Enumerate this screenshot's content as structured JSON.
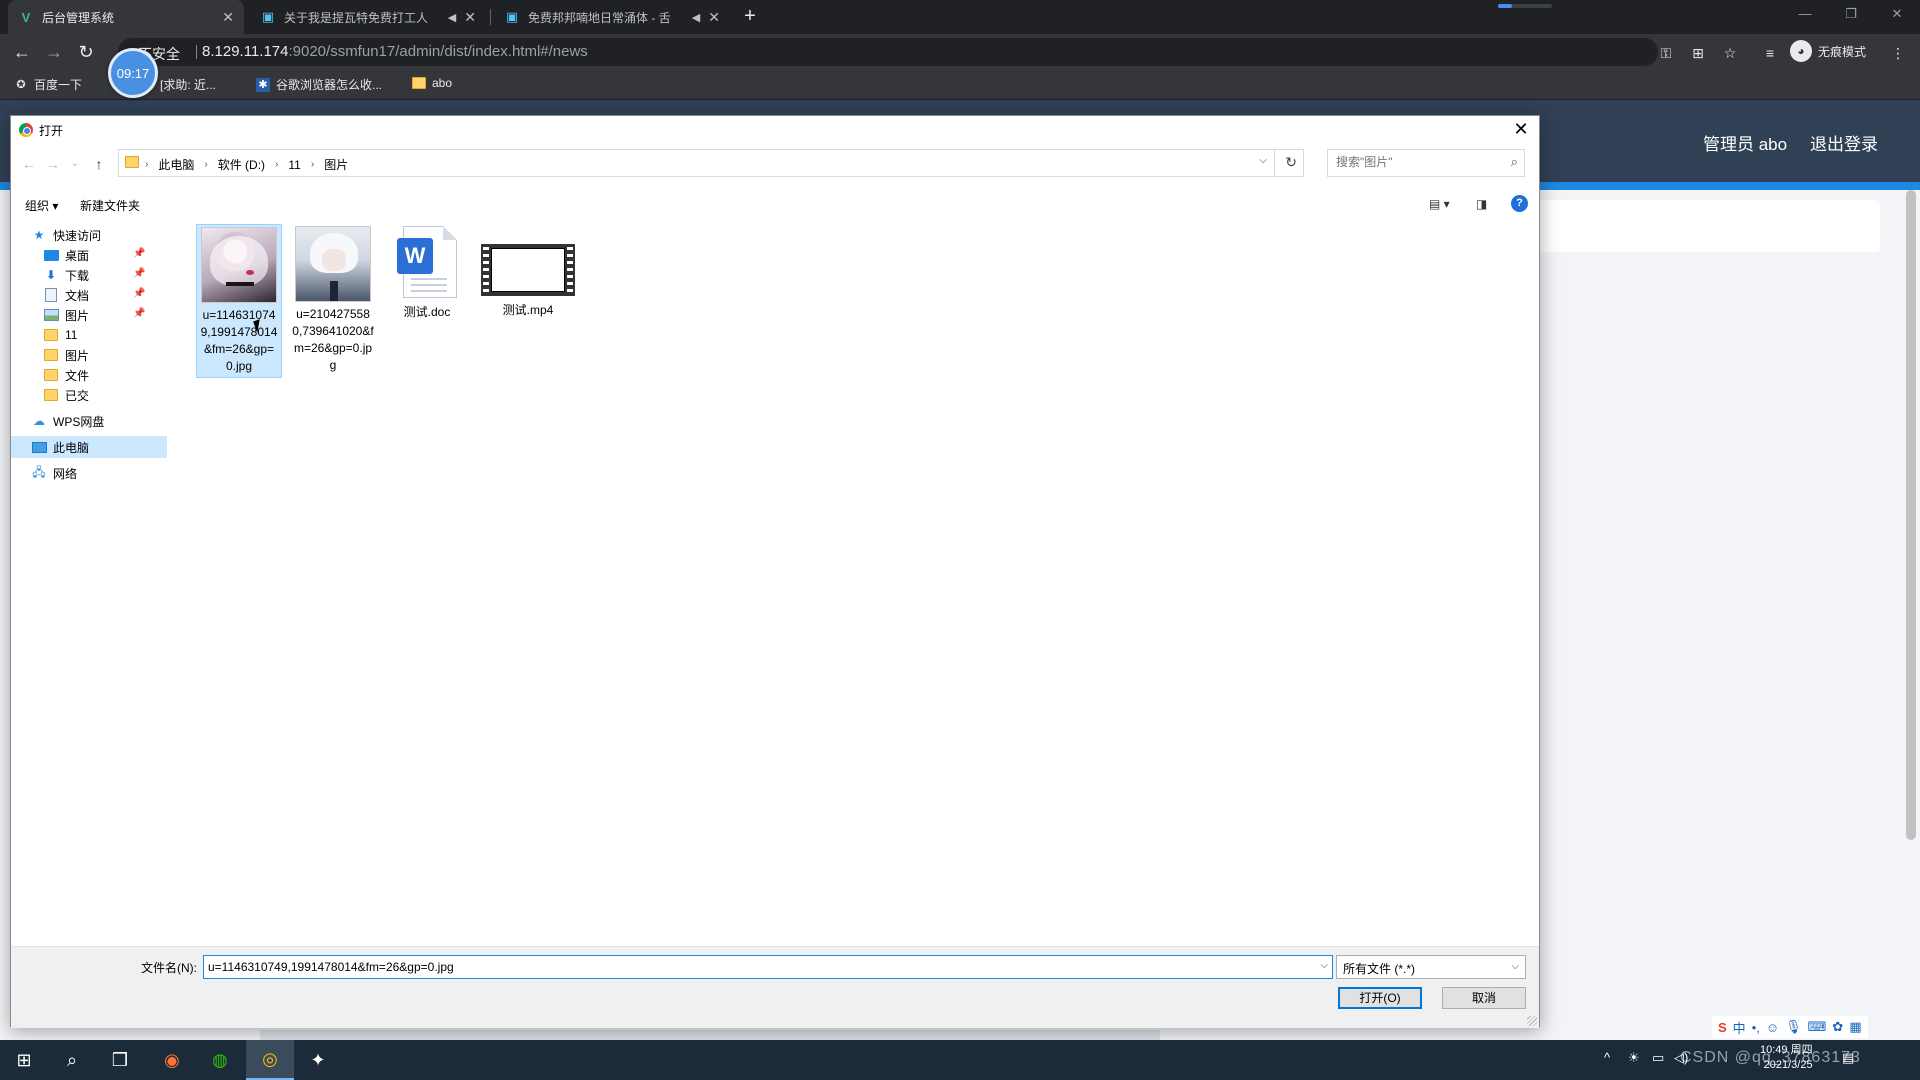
{
  "browser": {
    "tabs": [
      {
        "title": "后台管理系统",
        "icon": "vue-logo-icon",
        "active": true
      },
      {
        "title": "关于我是提瓦特免费打工人",
        "icon": "bilibili-icon",
        "active": false
      },
      {
        "title": "免费邦邦喃地日常涌体 - 舌",
        "icon": "bilibili-icon",
        "active": false
      }
    ],
    "address": {
      "security_label": "不安全",
      "host": "8.129.11.174",
      "path": ":9020/ssmfun17/admin/dist/index.html#/news"
    },
    "incognito_label": "无痕模式",
    "bookmarks": [
      {
        "label": "百度一下",
        "icon": "baidu-icon"
      },
      {
        "label": "[求助: 近...",
        "icon": "bookmark-icon"
      },
      {
        "label": "谷歌浏览器怎么收...",
        "icon": "bookmark-icon"
      },
      {
        "label": "abo",
        "icon": "folder-icon"
      }
    ],
    "timer_badge": "09:17"
  },
  "app": {
    "admin_user": "管理员 abo",
    "logout_label": "退出登录"
  },
  "dialog": {
    "title": "打开",
    "breadcrumbs": [
      "此电脑",
      "软件 (D:)",
      "11",
      "图片"
    ],
    "search_placeholder": "搜索\"图片\"",
    "organize_label": "组织 ▾",
    "new_folder_label": "新建文件夹",
    "help_label": "?",
    "nav": {
      "quick_access": "快速访问",
      "items": [
        {
          "label": "桌面",
          "pinned": true
        },
        {
          "label": "下载",
          "pinned": true
        },
        {
          "label": "文档",
          "pinned": true
        },
        {
          "label": "图片",
          "pinned": true
        },
        {
          "label": "11",
          "pinned": false
        },
        {
          "label": "图片",
          "pinned": false
        },
        {
          "label": "文件",
          "pinned": false
        },
        {
          "label": "已交",
          "pinned": false
        }
      ],
      "wps": "WPS网盘",
      "this_pc": "此电脑",
      "network": "网络"
    },
    "files": [
      {
        "name": "u=1146310749,1991478014&fm=26&gp=0.jpg",
        "type": "image",
        "selected": true
      },
      {
        "name": "u=2104275580,739641020&fm=26&gp=0.jpg",
        "type": "image",
        "selected": false
      },
      {
        "name": "测试.doc",
        "type": "word",
        "selected": false
      },
      {
        "name": "测试.mp4",
        "type": "video",
        "selected": false
      }
    ],
    "filename_label": "文件名(N):",
    "filename_value": "u=1146310749,1991478014&fm=26&gp=0.jpg",
    "filetype_value": "所有文件 (*.*)",
    "open_button": "打开(O)",
    "cancel_button": "取消"
  },
  "taskbar": {
    "clock_time": "10:49 周四",
    "clock_date": "2021/3/25",
    "watermark": "CSDN @qq_37863173",
    "ime_label": "中"
  },
  "colors": {
    "app_header": "#304156",
    "app_accent": "#1e88e5",
    "selection": "#cce8ff"
  }
}
